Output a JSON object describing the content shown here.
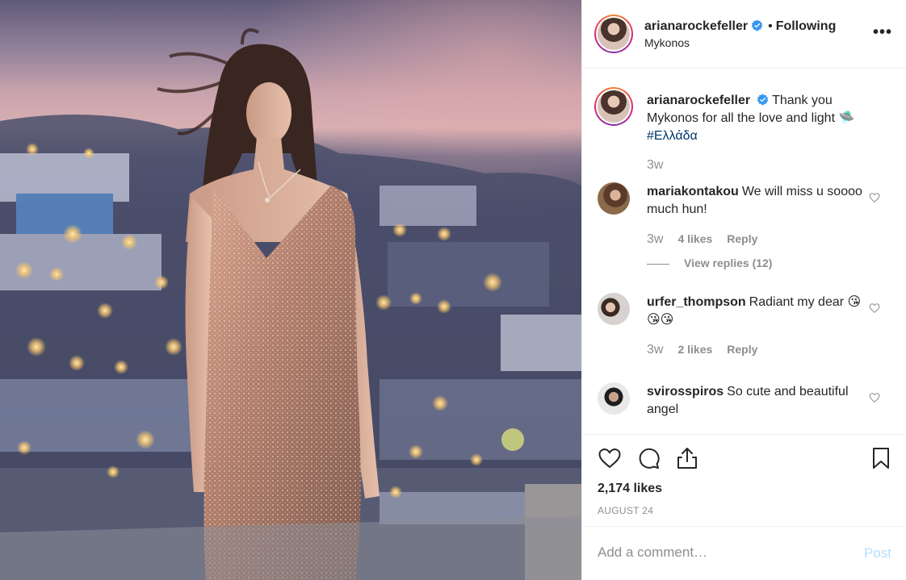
{
  "photo": {
    "alt": ""
  },
  "header": {
    "username": "arianarockefeller",
    "separator": "•",
    "follow_status": "Following",
    "location": "Mykonos",
    "more_label": "•••"
  },
  "caption": {
    "username": "arianarockefeller",
    "text": "Thank you Mykonos for all the love and light 🛸",
    "hashtag": "#Ελλάδα",
    "time": "3w"
  },
  "comments": [
    {
      "username": "mariakontakou",
      "text": "We will miss u soooo much hun!",
      "time": "3w",
      "likes": "4 likes",
      "reply": "Reply",
      "view_replies": "View replies (12)"
    },
    {
      "username": "urfer_thompson",
      "text": "Radiant my dear 😘😘😘",
      "time": "3w",
      "likes": "2 likes",
      "reply": "Reply"
    },
    {
      "username": "svirosspiros",
      "text": "So cute and beautiful angel"
    }
  ],
  "actions": {
    "like_icon": "heart-icon",
    "comment_icon": "comment-icon",
    "share_icon": "share-icon",
    "save_icon": "bookmark-icon",
    "likes_count": "2,174 likes",
    "date": "AUGUST 24"
  },
  "add_comment": {
    "placeholder": "Add a comment…",
    "post_label": "Post"
  },
  "colors": {
    "verified": "#3897f0",
    "link": "#00376b",
    "muted": "#8e8e8e",
    "post_disabled": "#b2dffc"
  }
}
